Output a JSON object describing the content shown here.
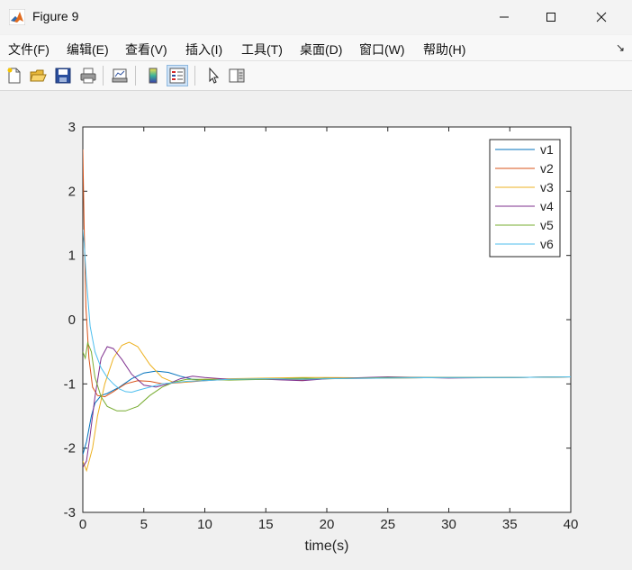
{
  "window": {
    "title": "Figure 9"
  },
  "menu": {
    "items": [
      {
        "label": "文件(F)"
      },
      {
        "label": "编辑(E)"
      },
      {
        "label": "查看(V)"
      },
      {
        "label": "插入(I)"
      },
      {
        "label": "工具(T)"
      },
      {
        "label": "桌面(D)"
      },
      {
        "label": "窗口(W)"
      },
      {
        "label": "帮助(H)"
      }
    ],
    "overflow_arrow": "↘"
  },
  "toolbar": {
    "icons": [
      "new-figure-icon",
      "open-file-icon",
      "save-icon",
      "print-icon",
      "link-plot-icon",
      "colorbar-icon",
      "legend-icon",
      "pointer-icon",
      "property-inspector-icon"
    ],
    "active": "legend-icon"
  },
  "chart_data": {
    "type": "line",
    "title": "",
    "xlabel": "time(s)",
    "ylabel": "",
    "xlim": [
      0,
      40
    ],
    "ylim": [
      -3,
      3
    ],
    "xticks": [
      0,
      5,
      10,
      15,
      20,
      25,
      30,
      35,
      40
    ],
    "yticks": [
      -3,
      -2,
      -1,
      0,
      1,
      2,
      3
    ],
    "grid": false,
    "legend_position": "top-right",
    "series": [
      {
        "name": "v1",
        "color": "#0072BD",
        "x": [
          0,
          0.3,
          0.7,
          1,
          1.5,
          2,
          3,
          4,
          5,
          6,
          7,
          8,
          9,
          10,
          12,
          15,
          18,
          20,
          25,
          30,
          35,
          40
        ],
        "y": [
          -2.1,
          -1.9,
          -1.5,
          -1.3,
          -1.18,
          -1.15,
          -1.05,
          -0.92,
          -0.83,
          -0.8,
          -0.82,
          -0.88,
          -0.93,
          -0.94,
          -0.93,
          -0.92,
          -0.93,
          -0.91,
          -0.9,
          -0.9,
          -0.9,
          -0.89
        ]
      },
      {
        "name": "v2",
        "color": "#D95319",
        "x": [
          0,
          0.1,
          0.25,
          0.5,
          0.8,
          1.2,
          1.8,
          2.5,
          3.5,
          4.5,
          5.5,
          6.5,
          8,
          10,
          12,
          15,
          18,
          20,
          25,
          30,
          35,
          40
        ],
        "y": [
          2.65,
          1.5,
          0.2,
          -0.6,
          -1.05,
          -1.18,
          -1.2,
          -1.12,
          -1.0,
          -0.95,
          -0.96,
          -1.0,
          -0.98,
          -0.95,
          -0.93,
          -0.93,
          -0.94,
          -0.92,
          -0.91,
          -0.9,
          -0.9,
          -0.89
        ]
      },
      {
        "name": "v3",
        "color": "#EDB120",
        "x": [
          0,
          0.3,
          0.8,
          1.2,
          1.8,
          2.5,
          3.2,
          3.8,
          4.5,
          5.5,
          6.5,
          7.5,
          8.5,
          10,
          12,
          15,
          18,
          20,
          25,
          30,
          35,
          40
        ],
        "y": [
          -2.2,
          -2.35,
          -2.0,
          -1.5,
          -1.0,
          -0.6,
          -0.4,
          -0.35,
          -0.42,
          -0.7,
          -0.9,
          -0.98,
          -0.97,
          -0.93,
          -0.92,
          -0.91,
          -0.9,
          -0.9,
          -0.91,
          -0.9,
          -0.9,
          -0.89
        ]
      },
      {
        "name": "v4",
        "color": "#7E2F8E",
        "x": [
          0,
          0.3,
          0.6,
          1.0,
          1.5,
          2.0,
          2.5,
          3.2,
          4,
          5,
          6,
          7,
          8,
          9,
          10,
          12,
          15,
          18,
          20,
          25,
          30,
          35,
          40
        ],
        "y": [
          -2.3,
          -2.2,
          -1.8,
          -1.2,
          -0.6,
          -0.42,
          -0.45,
          -0.62,
          -0.85,
          -1.02,
          -1.05,
          -1.0,
          -0.92,
          -0.88,
          -0.9,
          -0.93,
          -0.93,
          -0.95,
          -0.92,
          -0.89,
          -0.91,
          -0.9,
          -0.89
        ]
      },
      {
        "name": "v5",
        "color": "#77AC30",
        "x": [
          0,
          0.2,
          0.4,
          0.7,
          1.0,
          1.5,
          2.0,
          2.8,
          3.5,
          4.5,
          5.5,
          6.5,
          7.5,
          8.5,
          10,
          12,
          15,
          18,
          20,
          25,
          30,
          35,
          40
        ],
        "y": [
          -0.5,
          -0.6,
          -0.36,
          -0.5,
          -0.9,
          -1.2,
          -1.35,
          -1.42,
          -1.42,
          -1.35,
          -1.18,
          -1.05,
          -0.97,
          -0.93,
          -0.93,
          -0.94,
          -0.93,
          -0.91,
          -0.92,
          -0.9,
          -0.9,
          -0.9,
          -0.89
        ]
      },
      {
        "name": "v6",
        "color": "#4DBEEE",
        "x": [
          0,
          0.1,
          0.3,
          0.6,
          1.0,
          1.5,
          2.0,
          2.5,
          3.0,
          3.5,
          4.0,
          4.5,
          5.5,
          6.5,
          7.5,
          8.5,
          10,
          12,
          15,
          18,
          20,
          25,
          30,
          35,
          40
        ],
        "y": [
          1.4,
          1.2,
          0.6,
          -0.1,
          -0.5,
          -0.75,
          -0.9,
          -1.0,
          -1.08,
          -1.12,
          -1.13,
          -1.1,
          -1.05,
          -1.0,
          -0.98,
          -0.96,
          -0.95,
          -0.93,
          -0.92,
          -0.93,
          -0.92,
          -0.91,
          -0.9,
          -0.9,
          -0.89
        ]
      }
    ]
  }
}
